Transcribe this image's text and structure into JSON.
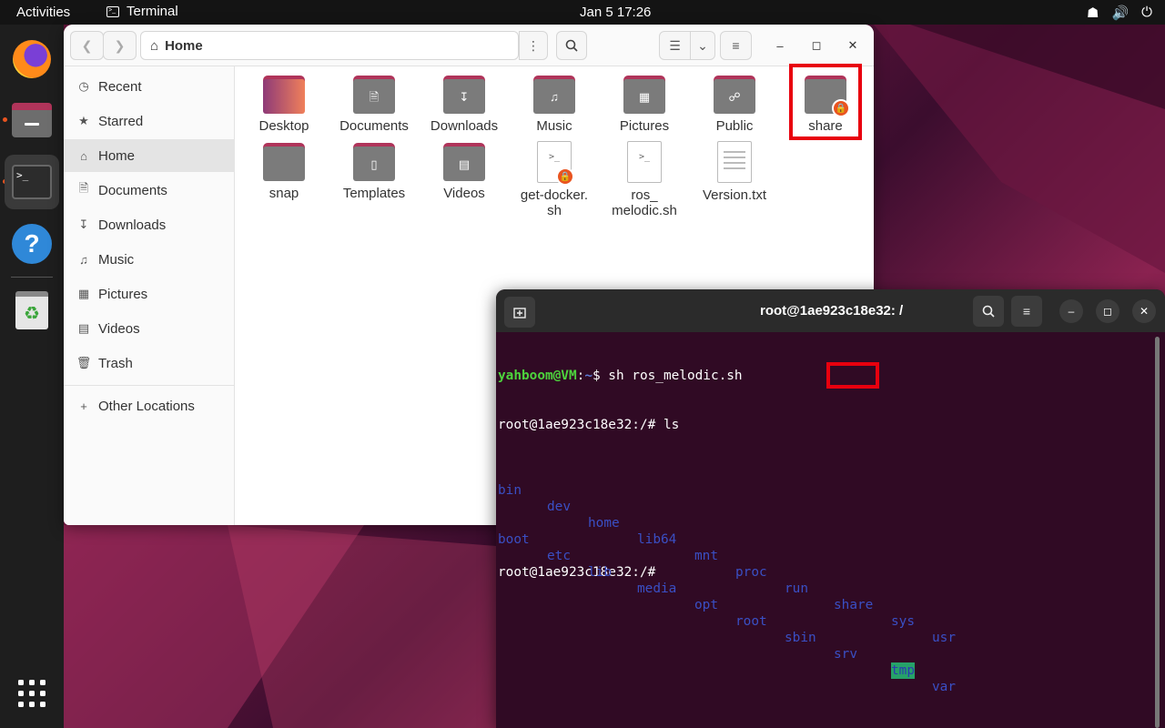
{
  "topbar": {
    "activities": "Activities",
    "app_name": "Terminal",
    "clock": "Jan 5  17:26"
  },
  "files": {
    "path": "Home",
    "sidebar": [
      {
        "label": "Recent",
        "icon": "clock-icon"
      },
      {
        "label": "Starred",
        "icon": "star-icon"
      },
      {
        "label": "Home",
        "icon": "home-icon",
        "selected": true
      },
      {
        "label": "Documents",
        "icon": "document-icon"
      },
      {
        "label": "Downloads",
        "icon": "download-icon"
      },
      {
        "label": "Music",
        "icon": "music-icon"
      },
      {
        "label": "Pictures",
        "icon": "picture-icon"
      },
      {
        "label": "Videos",
        "icon": "video-icon"
      },
      {
        "label": "Trash",
        "icon": "trash-icon"
      },
      {
        "label": "Other Locations",
        "icon": "plus-icon"
      }
    ],
    "items": [
      {
        "name": "Desktop",
        "kind": "folder"
      },
      {
        "name": "Documents",
        "kind": "folder"
      },
      {
        "name": "Downloads",
        "kind": "folder"
      },
      {
        "name": "Music",
        "kind": "folder"
      },
      {
        "name": "Pictures",
        "kind": "folder"
      },
      {
        "name": "Public",
        "kind": "folder"
      },
      {
        "name": "share",
        "kind": "folder",
        "locked": true
      },
      {
        "name": "snap",
        "kind": "folder"
      },
      {
        "name": "Templates",
        "kind": "folder"
      },
      {
        "name": "Videos",
        "kind": "folder"
      },
      {
        "name": "get-docker.\nsh",
        "kind": "script",
        "locked": true
      },
      {
        "name": "ros_\nmelodic.sh",
        "kind": "script"
      },
      {
        "name": "Version.txt",
        "kind": "text"
      }
    ]
  },
  "terminal": {
    "title": "root@1ae923c18e32: /",
    "line1_user": "yahboom@VM",
    "line1_sep": ":",
    "line1_path": "~",
    "line1_cmd": "$ sh ros_melodic.sh",
    "line2": "root@1ae923c18e32:/# ls",
    "ls_row1": [
      "bin",
      "dev",
      "home",
      "lib64",
      "mnt",
      "proc",
      "run",
      "share",
      "sys",
      "usr"
    ],
    "ls_row2": [
      "boot",
      "etc",
      "lib",
      "media",
      "opt",
      "root",
      "sbin",
      "srv",
      "tmp",
      "var"
    ],
    "line4": "root@1ae923c18e32:/#"
  },
  "colors": {
    "accent": "#e95420",
    "highlight_box": "#e8000e",
    "terminal_bg": "#300a24"
  }
}
